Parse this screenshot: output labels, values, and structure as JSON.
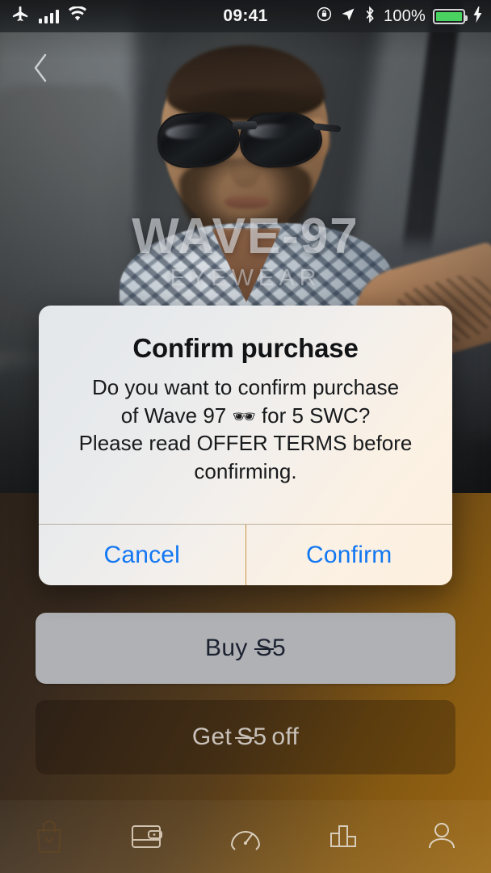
{
  "status_bar": {
    "time": "09:41",
    "battery_percent": "100%",
    "icons": [
      "airplane-mode-icon",
      "cellular-signal-icon",
      "wifi-icon",
      "rotation-lock-icon",
      "location-arrow-icon",
      "bluetooth-icon",
      "battery-icon",
      "charging-bolt-icon"
    ]
  },
  "hero": {
    "back_label": "‹",
    "brand_name": "WAVE-97",
    "brand_sub": "EYEWEAR"
  },
  "product": {
    "title": "Wave 97",
    "buy_label": "Buy",
    "buy_amount": "5",
    "get_prefix": "Get",
    "get_amount": "5",
    "get_suffix": "off",
    "currency_glyph": "S"
  },
  "dialog": {
    "title": "Confirm purchase",
    "message_line1": "Do you want to confirm purchase",
    "message_line2_pre": "of Wave 97",
    "message_emoji": "🕶",
    "message_line2_post": "for 5 SWC?",
    "message_line3": "Please read OFFER TERMS before",
    "message_line4": "confirming.",
    "cancel_label": "Cancel",
    "confirm_label": "Confirm",
    "accent_color": "#1277f2"
  },
  "tabbar": {
    "items": [
      {
        "name": "shop",
        "icon": "shopping-bag-icon",
        "active": false
      },
      {
        "name": "wallet",
        "icon": "wallet-icon",
        "active": true
      },
      {
        "name": "speed",
        "icon": "gauge-icon",
        "active": true
      },
      {
        "name": "stats",
        "icon": "bar-chart-icon",
        "active": true
      },
      {
        "name": "profile",
        "icon": "person-icon",
        "active": true
      }
    ]
  }
}
